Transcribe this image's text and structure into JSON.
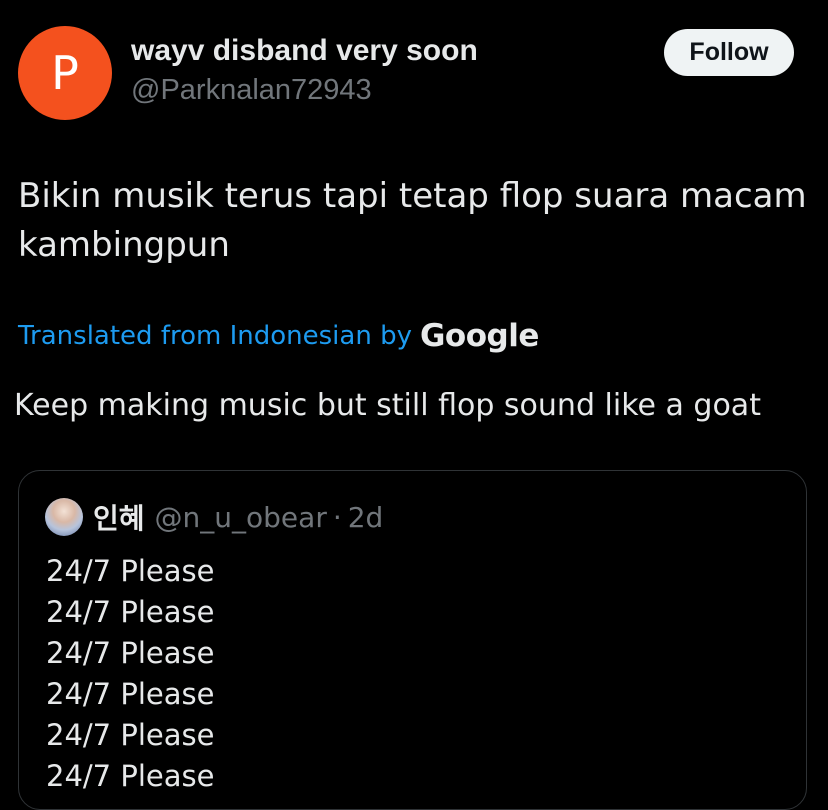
{
  "post": {
    "avatar_letter": "P",
    "avatar_color": "#f4511e",
    "display_name": "wayv disband very soon",
    "handle": "@Parknalan72943",
    "follow_label": "Follow",
    "text": "Bikin musik terus tapi tetap flop suara macam kambingpun",
    "translation_label": "Translated from Indonesian by",
    "translation_provider": "Google",
    "translated_text": "Keep making music but still flop sound like a goat"
  },
  "quote": {
    "avatar_icon": "user-photo-avatar",
    "name": "인혜",
    "handle": "@n_u_obear",
    "separator": "·",
    "time": "2d",
    "lines": [
      "24/7 Please",
      "24/7 Please",
      "24/7 Please",
      "24/7 Please",
      "24/7 Please",
      "24/7 Please"
    ]
  },
  "colors": {
    "background": "#000000",
    "text": "#e7e9ea",
    "secondary_text": "#71767b",
    "link": "#1d9bf0",
    "follow_button_bg": "#eff3f4",
    "border": "#2f3336"
  }
}
